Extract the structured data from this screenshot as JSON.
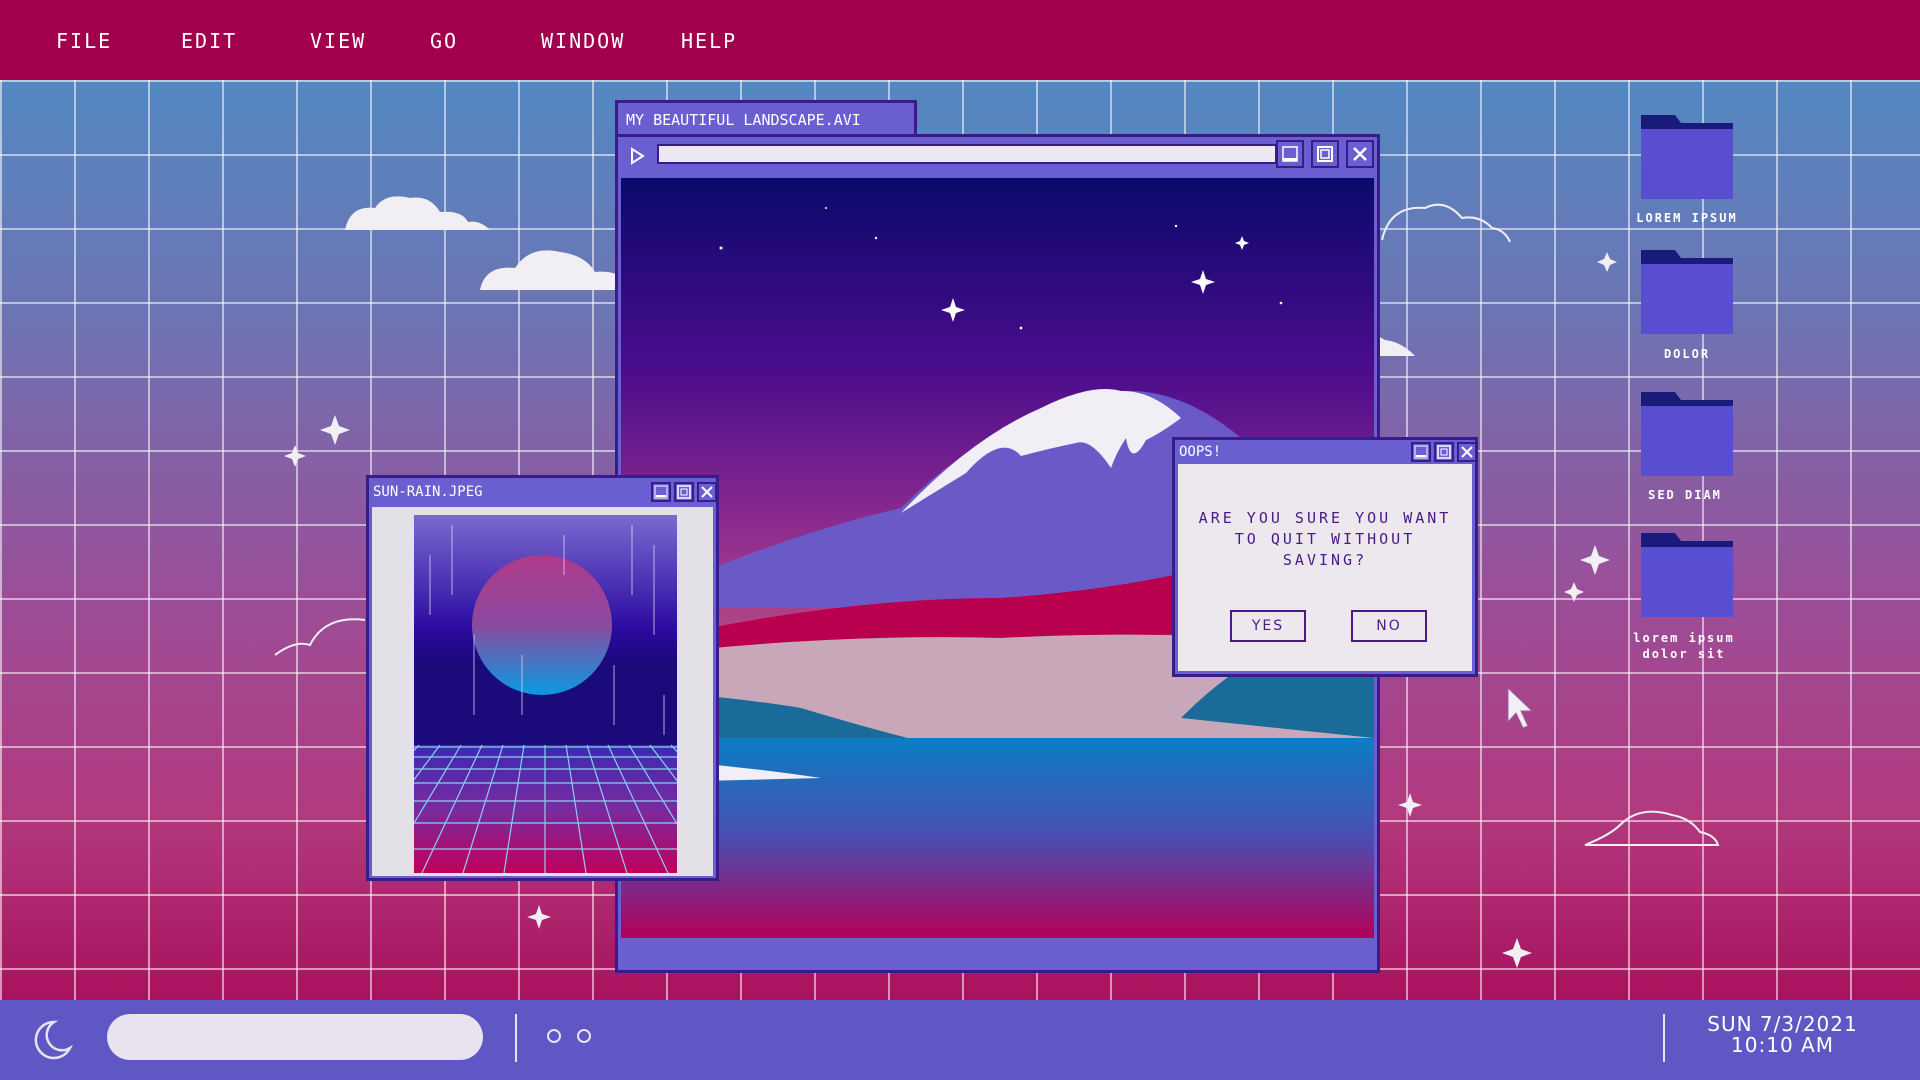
{
  "menubar": {
    "items": [
      "FILE",
      "EDIT",
      "VIEW",
      "GO",
      "WINDOW",
      "HELP"
    ]
  },
  "video_window": {
    "title": "MY BEAUTIFUL LANDSCAPE.AVI",
    "progress": 0
  },
  "image_window": {
    "title": "SUN-RAIN.JPEG"
  },
  "dialog": {
    "title": "OOPS!",
    "message": "ARE YOU SURE YOU WANT TO QUIT WITHOUT SAVING?",
    "yes_label": "YES",
    "no_label": "NO"
  },
  "desktop": {
    "folders": [
      {
        "label": "LOREM IPSUM"
      },
      {
        "label": "DOLOR"
      },
      {
        "label": "SED DIAM"
      },
      {
        "label": "lorem ipsum dolor sit"
      }
    ]
  },
  "taskbar": {
    "date": "SUN 7/3/2021",
    "time": "10:10 AM"
  },
  "colors": {
    "menubar": "#a1004d",
    "taskbar": "#5f57c4",
    "window_purple": "#6a5fd0",
    "window_border": "#3a1b8a"
  }
}
